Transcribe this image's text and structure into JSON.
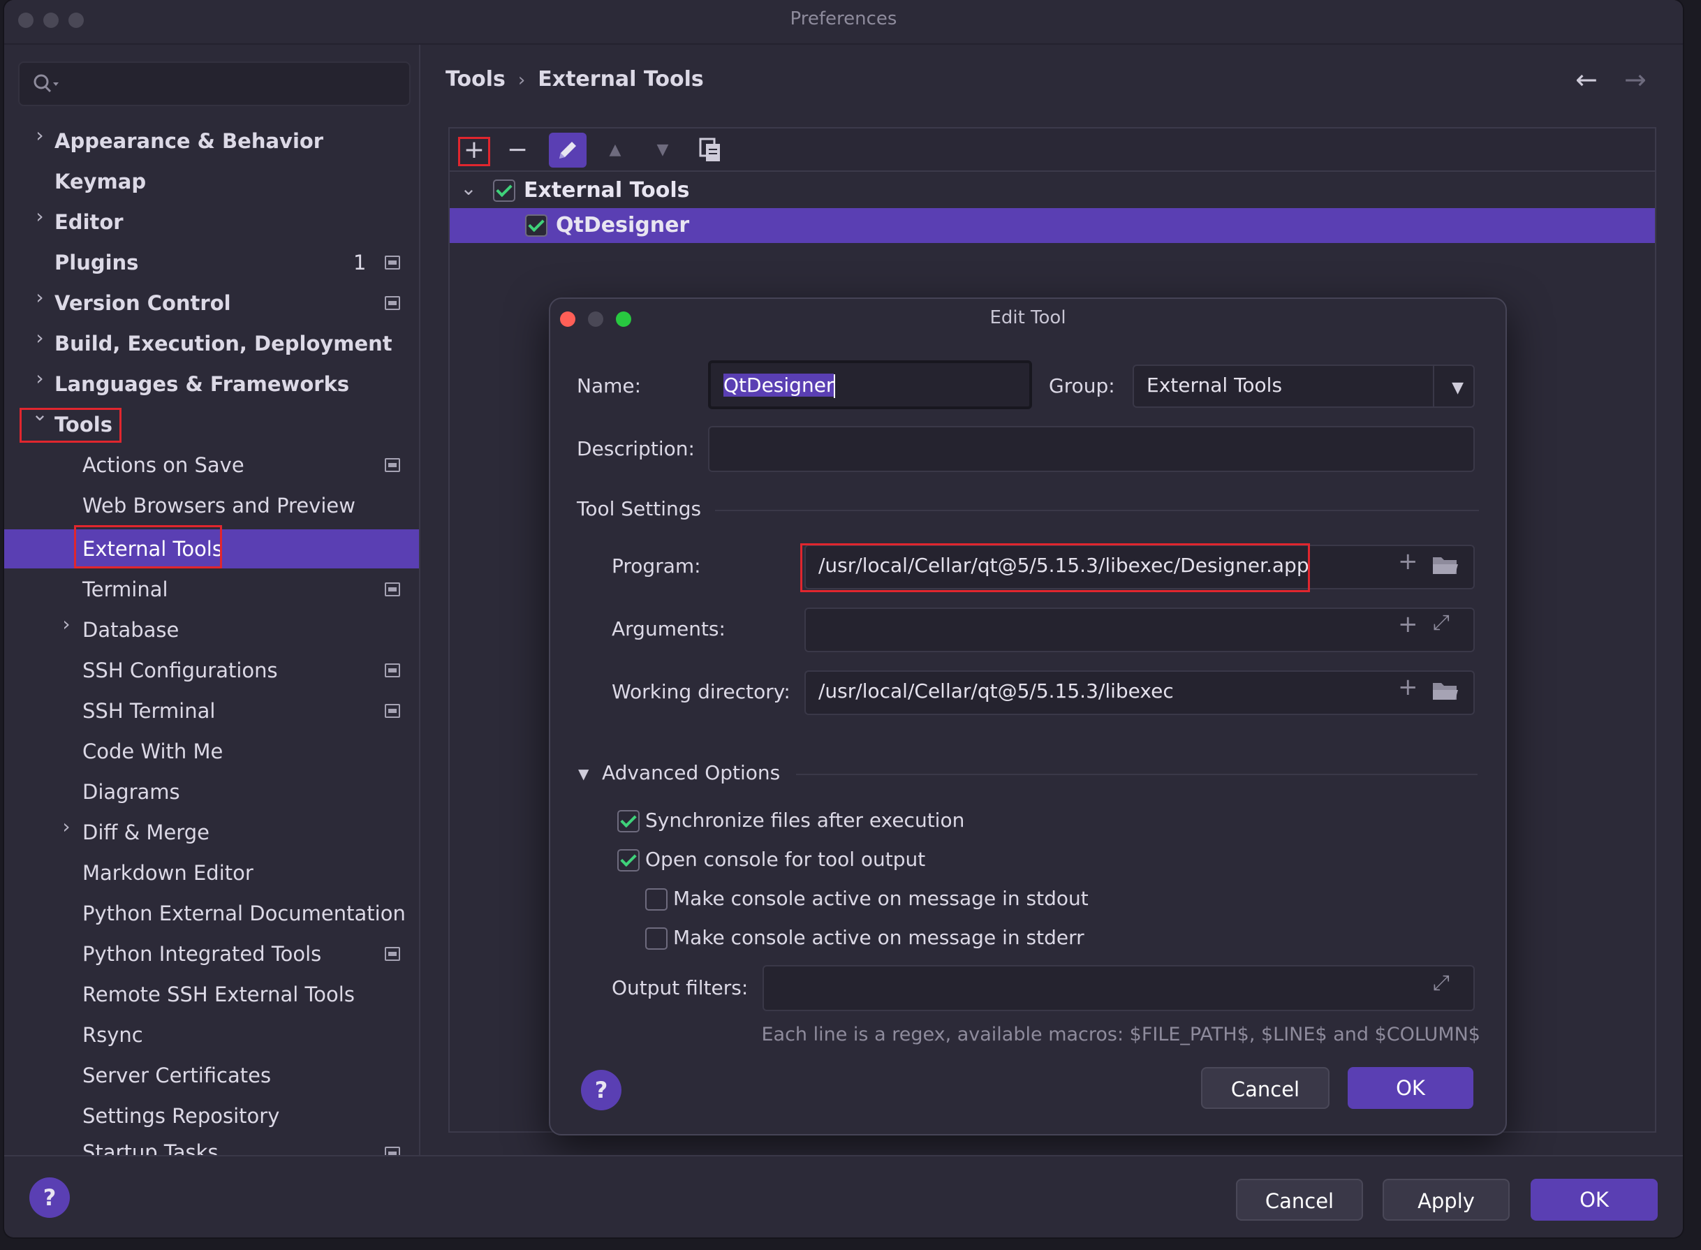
{
  "window": {
    "title": "Preferences"
  },
  "sidebar": {
    "items": [
      {
        "label": "Appearance & Behavior",
        "arrow": "›"
      },
      {
        "label": "Keymap"
      },
      {
        "label": "Editor",
        "arrow": "›"
      },
      {
        "label": "Plugins",
        "badge": "1"
      },
      {
        "label": "Version Control",
        "arrow": "›"
      },
      {
        "label": "Build, Execution, Deployment",
        "arrow": "›"
      },
      {
        "label": "Languages & Frameworks",
        "arrow": "›"
      },
      {
        "label": "Tools",
        "arrow": "⌄"
      },
      {
        "label": "Actions on Save"
      },
      {
        "label": "Web Browsers and Preview"
      },
      {
        "label": "External Tools"
      },
      {
        "label": "Terminal"
      },
      {
        "label": "Database",
        "arrow": "›"
      },
      {
        "label": "SSH Configurations"
      },
      {
        "label": "SSH Terminal"
      },
      {
        "label": "Code With Me"
      },
      {
        "label": "Diagrams"
      },
      {
        "label": "Diff & Merge",
        "arrow": "›"
      },
      {
        "label": "Markdown Editor"
      },
      {
        "label": "Python External Documentation"
      },
      {
        "label": "Python Integrated Tools"
      },
      {
        "label": "Remote SSH External Tools"
      },
      {
        "label": "Rsync"
      },
      {
        "label": "Server Certificates"
      },
      {
        "label": "Settings Repository"
      },
      {
        "label": "Startup Tasks"
      }
    ]
  },
  "breadcrumb": {
    "parent": "Tools",
    "sep": "›",
    "current": "External Tools"
  },
  "nav": {
    "back": "←",
    "forward": "→"
  },
  "toolbar": {
    "add": "+",
    "remove": "−",
    "up": "▲",
    "down": "▼"
  },
  "tree": {
    "group_label": "External Tools",
    "group_arrow": "⌄",
    "item_label": "QtDesigner"
  },
  "dialog": {
    "title": "Edit Tool",
    "name_label": "Name:",
    "name_value": "QtDesigner",
    "group_label": "Group:",
    "group_value": "External Tools",
    "description_label": "Description:",
    "description_value": "",
    "tool_settings_label": "Tool Settings",
    "program_label": "Program:",
    "program_value": "/usr/local/Cellar/qt@5/5.15.3/libexec/Designer.app",
    "arguments_label": "Arguments:",
    "arguments_value": "",
    "workdir_label": "Working directory:",
    "workdir_value": "/usr/local/Cellar/qt@5/5.15.3/libexec",
    "advanced_label": "Advanced Options",
    "opt_sync": "Synchronize files after execution",
    "opt_console": "Open console for tool output",
    "opt_stdout": "Make console active on message in stdout",
    "opt_stderr": "Make console active on message in stderr",
    "output_filters_label": "Output filters:",
    "output_filters_value": "",
    "hint": "Each line is a regex, available macros: $FILE_PATH$, $LINE$ and $COLUMN$",
    "cancel": "Cancel",
    "ok": "OK",
    "help": "?"
  },
  "footer": {
    "help": "?",
    "cancel": "Cancel",
    "apply": "Apply",
    "ok": "OK"
  },
  "colors": {
    "accent": "#5a3fb3",
    "highlight_box": "#e0262e",
    "check": "#3fd17a",
    "background": "#2c2a38"
  }
}
